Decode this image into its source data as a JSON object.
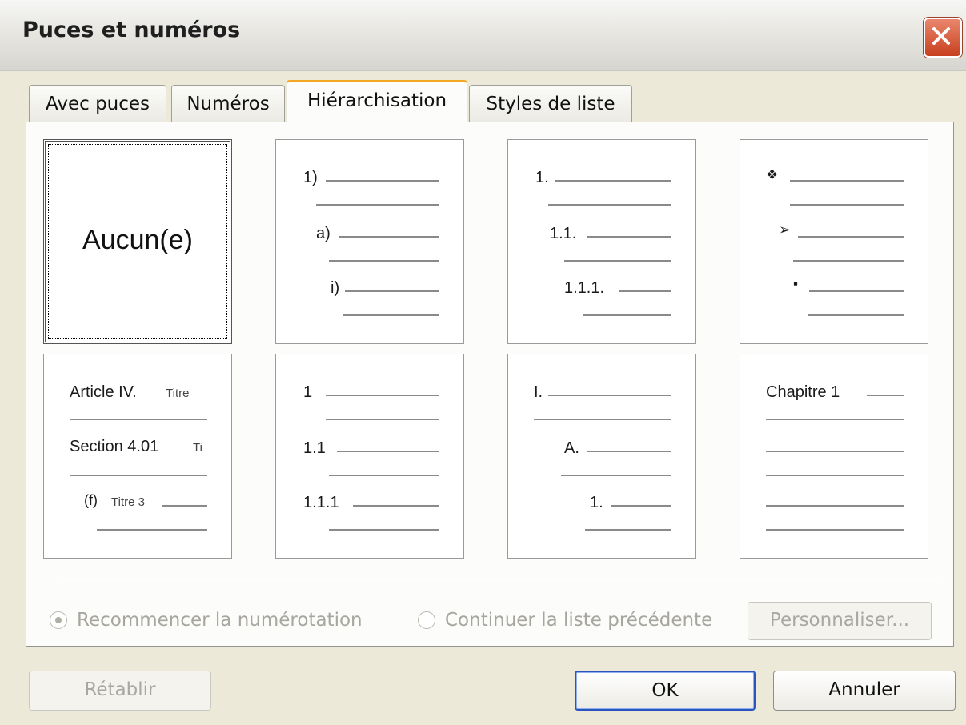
{
  "window": {
    "title": "Puces et numéros",
    "close_icon": "close-icon"
  },
  "tabs": [
    {
      "label": "Avec puces",
      "active": false
    },
    {
      "label": "Numéros",
      "active": false
    },
    {
      "label": "Hiérarchisation",
      "active": true
    },
    {
      "label": "Styles de liste",
      "active": false
    }
  ],
  "presets": [
    {
      "name": "none",
      "label": "Aucun(e)",
      "selected": true
    },
    {
      "name": "numbered-paren",
      "markers": [
        "1)",
        "a)",
        "i)"
      ]
    },
    {
      "name": "decimal-nested",
      "markers": [
        "1.",
        "1.1.",
        "1.1.1."
      ]
    },
    {
      "name": "symbol-bullets",
      "markers": [
        "❖",
        "➢",
        "▪"
      ]
    },
    {
      "name": "legal",
      "markers": [
        "Article IV.",
        "Section 4.01",
        "(f)"
      ],
      "titles": [
        "Titre",
        "Ti",
        "Titre 3"
      ]
    },
    {
      "name": "decimal-plain",
      "markers": [
        "1",
        "1.1",
        "1.1.1"
      ]
    },
    {
      "name": "roman-alpha",
      "markers": [
        "I.",
        "A.",
        "1."
      ]
    },
    {
      "name": "chapter",
      "markers": [
        "Chapitre 1"
      ]
    }
  ],
  "options": {
    "restart_label": "Recommencer la numérotation",
    "continue_label": "Continuer la liste précédente",
    "customize_label": "Personnaliser..."
  },
  "buttons": {
    "reset": "Rétablir",
    "ok": "OK",
    "cancel": "Annuler"
  }
}
